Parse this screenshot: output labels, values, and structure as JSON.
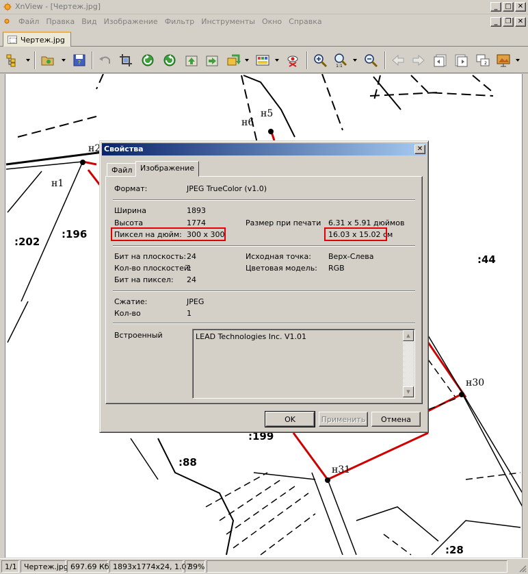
{
  "window": {
    "title": "XnView - [Чертеж.jpg]"
  },
  "menu": {
    "items": [
      "Файл",
      "Правка",
      "Вид",
      "Изображение",
      "Фильтр",
      "Инструменты",
      "Окно",
      "Справка"
    ]
  },
  "tab": {
    "label": "Чертеж.jpg"
  },
  "toolbar": {
    "icons": [
      "browser-icon",
      "open-folder-icon",
      "save-icon",
      "undo-icon",
      "crop-icon",
      "rotate-left-icon",
      "rotate-right-icon",
      "previous-file-icon",
      "next-file-icon",
      "convert-icon",
      "adjust-colors-icon",
      "red-eye-icon",
      "zoom-in-icon",
      "zoom-fit-icon",
      "zoom-out-icon",
      "arrow-left-icon",
      "arrow-right-icon",
      "first-page-icon",
      "last-page-icon",
      "multipage-icon",
      "slideshow-icon"
    ]
  },
  "drawing": {
    "labels": {
      "n1": "н1",
      "n2": "н2",
      "n5": "н5",
      "n6": "н6",
      "n30": "н30",
      "n31": "н31",
      "p202": ":202",
      "p196": ":196",
      "p44": ":44",
      "p199": ":199",
      "p88": ":88",
      "p28": ":28"
    }
  },
  "dialog": {
    "title": "Свойства",
    "tabs": {
      "file": "Файл",
      "image": "Изображение"
    },
    "format": {
      "label": "Формат:",
      "value": "JPEG TrueColor (v1.0)"
    },
    "width": {
      "label": "Ширина",
      "value": "1893"
    },
    "height": {
      "label": "Высота",
      "value": "1774"
    },
    "dpi": {
      "label": "Пиксел на дюйм:",
      "value": "300 x 300"
    },
    "print_size": {
      "label": "Размер при печати",
      "inches": "6.31 x 5.91 дюймов",
      "cm": "16.03 x 15.02 см"
    },
    "bits_per_plane": {
      "label": "Бит на плоскость:",
      "value": "24"
    },
    "planes": {
      "label": "Кол-во плоскостей:",
      "value": "1"
    },
    "bits_per_pixel": {
      "label": "Бит на пиксел:",
      "value": "24"
    },
    "origin": {
      "label": "Исходная точка:",
      "value": "Верх-Слева"
    },
    "color_model": {
      "label": "Цветовая модель:",
      "value": "RGB"
    },
    "compression": {
      "label": "Сжатие:",
      "value": "JPEG"
    },
    "count": {
      "label": "Кол-во",
      "value": "1"
    },
    "embedded": {
      "label": "Встроенный",
      "value": "LEAD Technologies Inc. V1.01"
    },
    "buttons": {
      "ok": "OK",
      "apply": "Применить",
      "cancel": "Отмена"
    },
    "highlight_color": "#e00000"
  },
  "status": {
    "page": "1/1",
    "filename": "Чертеж.jpg",
    "filesize": "697.69 Кб",
    "dimensions": "1893x1774x24, 1.07",
    "zoom": "39%"
  }
}
